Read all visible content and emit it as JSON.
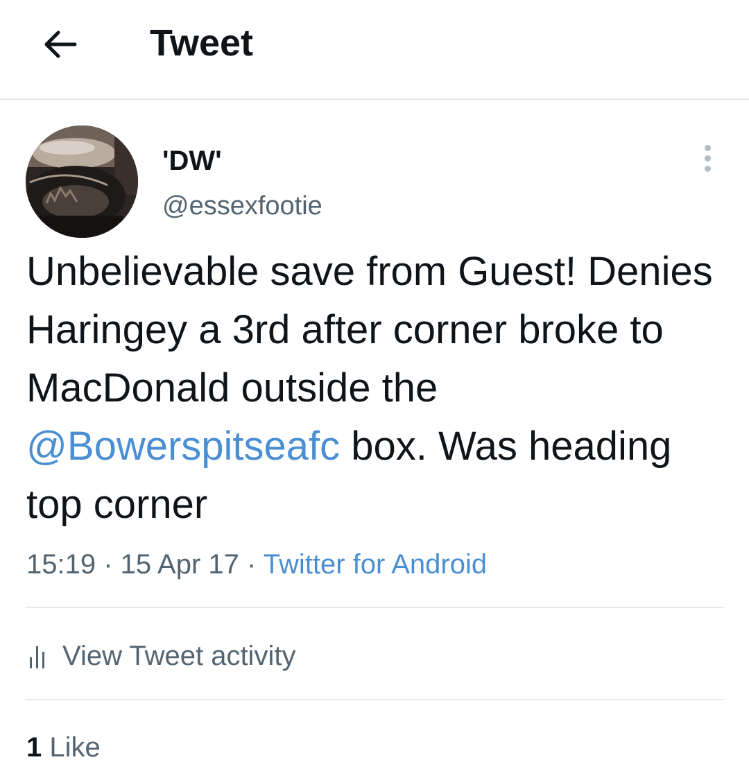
{
  "header": {
    "title": "Tweet",
    "back_icon": "arrow-left-icon"
  },
  "tweet": {
    "author": {
      "display_name": "'DW'",
      "handle": "@essexfootie",
      "avatar_icon": "profile-photo"
    },
    "more_icon": "vertical-ellipsis-icon",
    "text": {
      "part1": "Unbelievable save from Guest! Denies Haringey a 3rd after corner broke to MacDonald outside the ",
      "mention": "@Bowerspitseafc",
      "part2": " box. Was heading top corner"
    },
    "time": "15:19",
    "separator": " · ",
    "date": "15 Apr 17",
    "source": "Twitter for Android"
  },
  "activity": {
    "label": "View Tweet activity",
    "icon": "bar-chart-icon"
  },
  "likes": {
    "count": "1",
    "label": "Like"
  },
  "colors": {
    "link": "#4a8fd3",
    "text_primary": "#0f1419",
    "text_secondary": "#536471",
    "divider": "#e6e9eb"
  }
}
